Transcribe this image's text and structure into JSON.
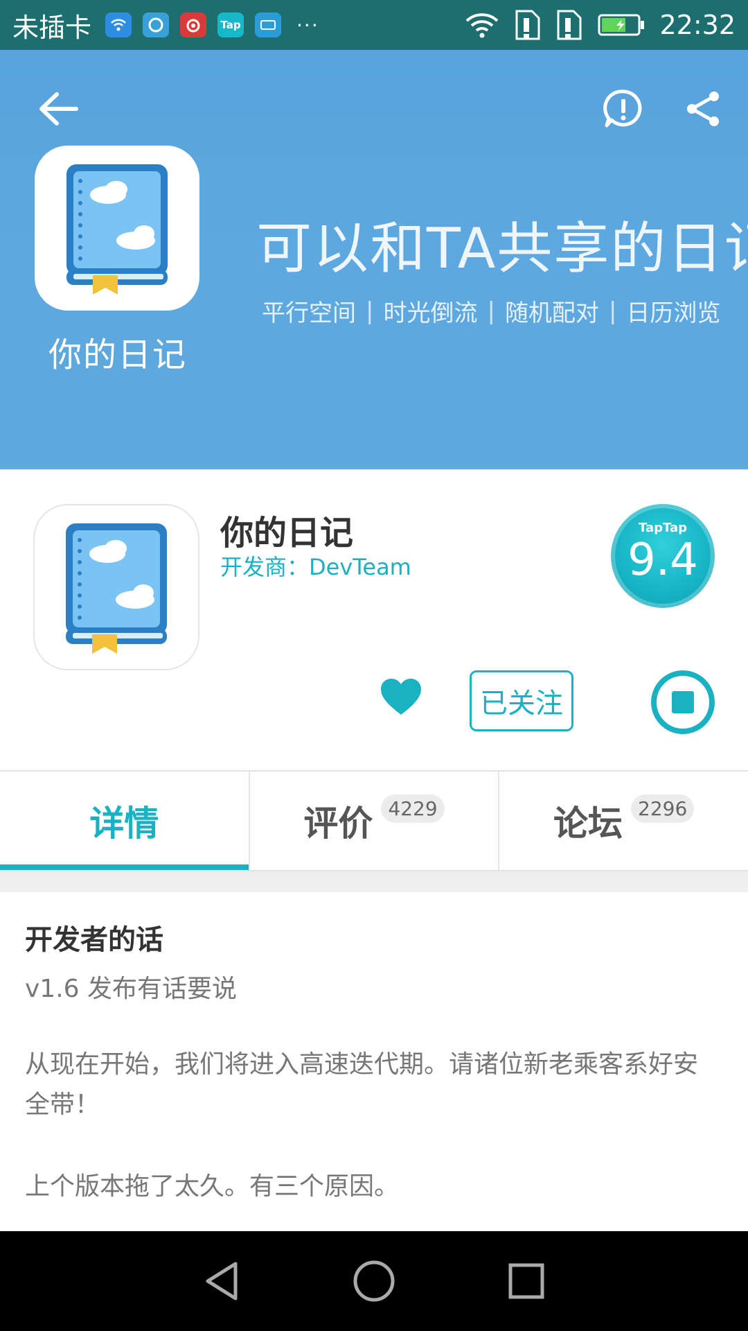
{
  "status_bar": {
    "carrier": "未插卡",
    "notification_icons": [
      "wifi-hotspot-icon",
      "qq-browser-icon",
      "netease-music-icon",
      "taptap-icon",
      "miui-icon"
    ],
    "tap_label": "Tap",
    "more": "···",
    "time": "22:32"
  },
  "hero": {
    "app_name": "你的日记",
    "slogan": "可以和TA共享的日记",
    "features": [
      "平行空间",
      "时光倒流",
      "随机配对",
      "日历浏览"
    ]
  },
  "app_info": {
    "title": "你的日记",
    "developer": "开发商：DevTeam",
    "rating_brand": "TapTap",
    "rating_score": "9.4",
    "follow_label": "已关注"
  },
  "tabs": [
    {
      "label": "详情",
      "count": "",
      "active": true
    },
    {
      "label": "评价",
      "count": "4229",
      "active": false
    },
    {
      "label": "论坛",
      "count": "2296",
      "active": false
    }
  ],
  "content": {
    "title": "开发者的话",
    "version": "v1.6 发布有话要说",
    "paragraph_1": "从现在开始，我们将进入高速迭代期。请诸位新老乘客系好安全带！",
    "paragraph_2": "上个版本拖了太久。有三个原因。"
  },
  "colors": {
    "accent": "#1ab1c2",
    "hero_bg": "#5ca7df",
    "status_bar_bg": "#1d6e6e"
  }
}
